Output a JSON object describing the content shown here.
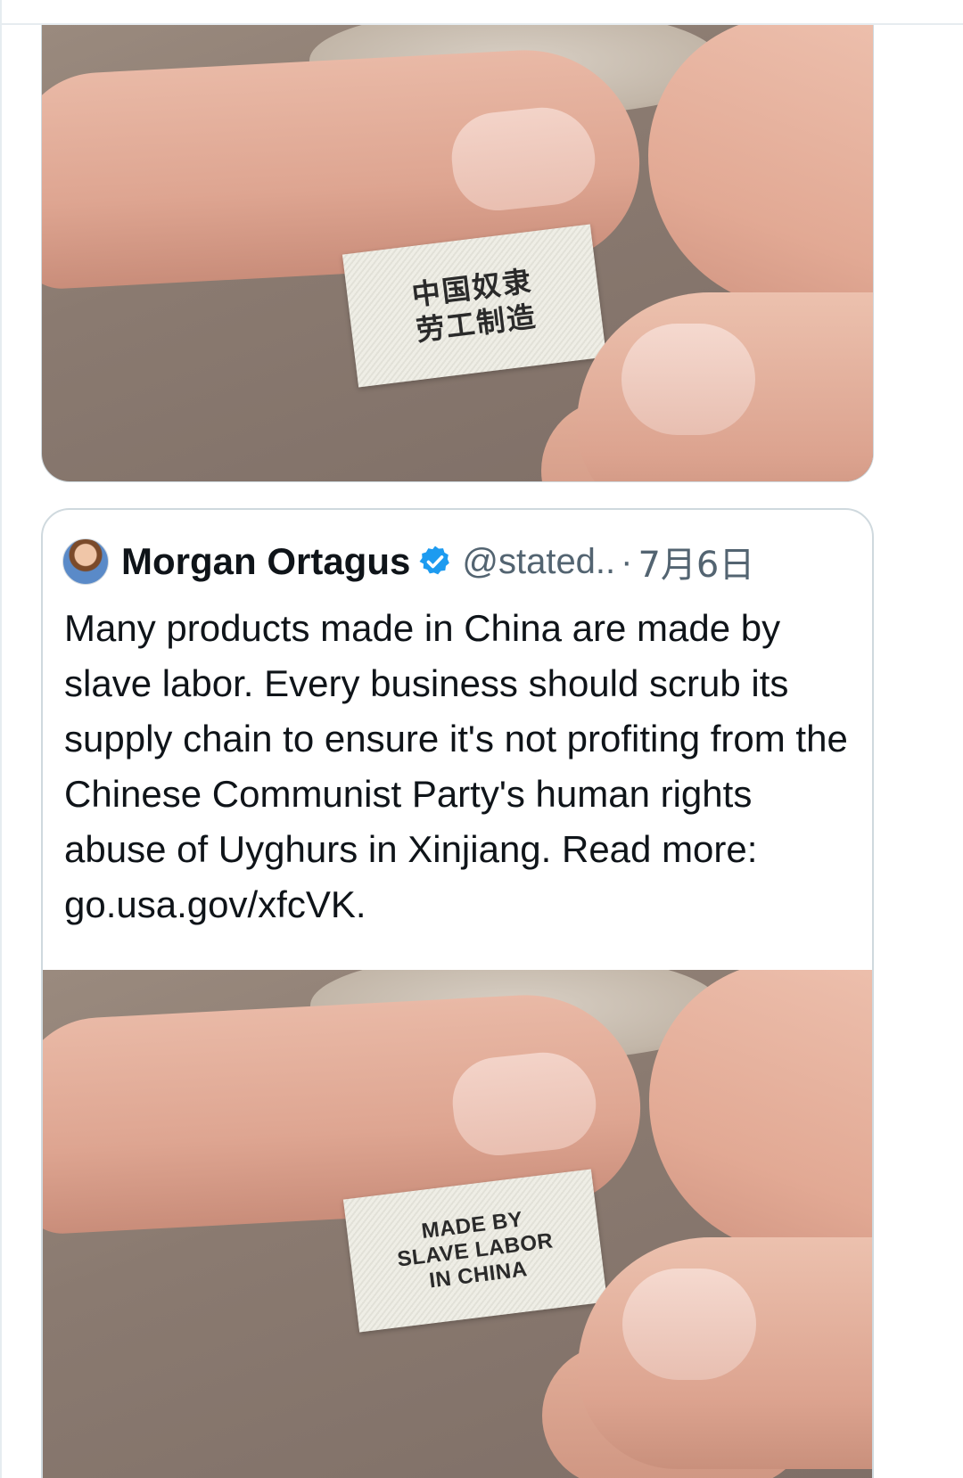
{
  "top_image": {
    "tag_lines": [
      "中国奴隶",
      "劳工制造"
    ]
  },
  "quoted_tweet": {
    "author_name": "Morgan Ortagus",
    "handle": "@stated..",
    "separator": "·",
    "date": "7月6日",
    "text": "Many products made in China are made by slave labor. Every business should scrub its supply chain to ensure it's not profiting from the Chinese Communist Party's human rights abuse of Uyghurs in Xinjiang. Read more: go.usa.gov/xfcVK.",
    "image": {
      "tag_lines": [
        "MADE BY",
        "SLAVE LABOR",
        "IN CHINA"
      ]
    }
  },
  "colors": {
    "verified": "#1d9bf0",
    "text_primary": "#0f1419",
    "text_secondary": "#536471",
    "border": "#cfd9de"
  },
  "icons": {
    "verified": "verified-badge-icon"
  }
}
